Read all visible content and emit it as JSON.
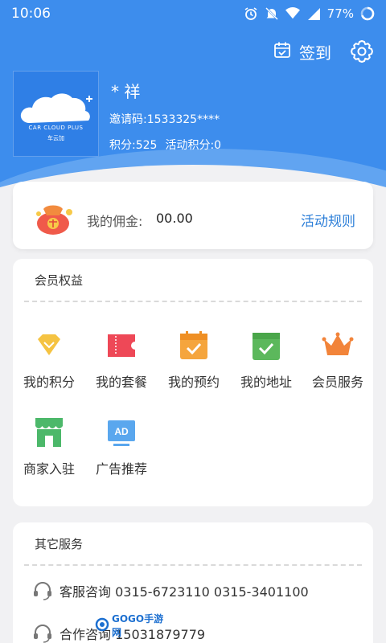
{
  "status_bar": {
    "time": "10:06",
    "battery": "77%"
  },
  "header": {
    "signin_label": "签到"
  },
  "profile": {
    "name": "* 祥",
    "invite_code": "邀请码:1533325****",
    "points": "积分:525",
    "activity_points": "活动积分:0",
    "logo_text": "CAR CLOUD PLUS",
    "logo_subtext": "车云加"
  },
  "commission": {
    "label": "我的佣金:",
    "value": "00.00",
    "rules_link": "活动规则"
  },
  "benefits": {
    "title": "会员权益",
    "items": [
      {
        "label": "我的积分",
        "icon": "diamond-icon"
      },
      {
        "label": "我的套餐",
        "icon": "ticket-icon"
      },
      {
        "label": "我的预约",
        "icon": "calendar-check-icon"
      },
      {
        "label": "我的地址",
        "icon": "box-check-icon"
      },
      {
        "label": "会员服务",
        "icon": "crown-icon"
      },
      {
        "label": "商家入驻",
        "icon": "store-icon"
      },
      {
        "label": "广告推荐",
        "icon": "ad-screen-icon"
      }
    ]
  },
  "other_services": {
    "title": "其它服务",
    "rows": [
      {
        "text": "客服咨询  0315-6723110  0315-3401100"
      },
      {
        "text": "合作咨询  15031879779"
      }
    ]
  },
  "watermark": "GOGO手游网",
  "colors": {
    "primary": "#3d8ded",
    "link": "#2d7fd8",
    "background": "#f1f1f3"
  }
}
